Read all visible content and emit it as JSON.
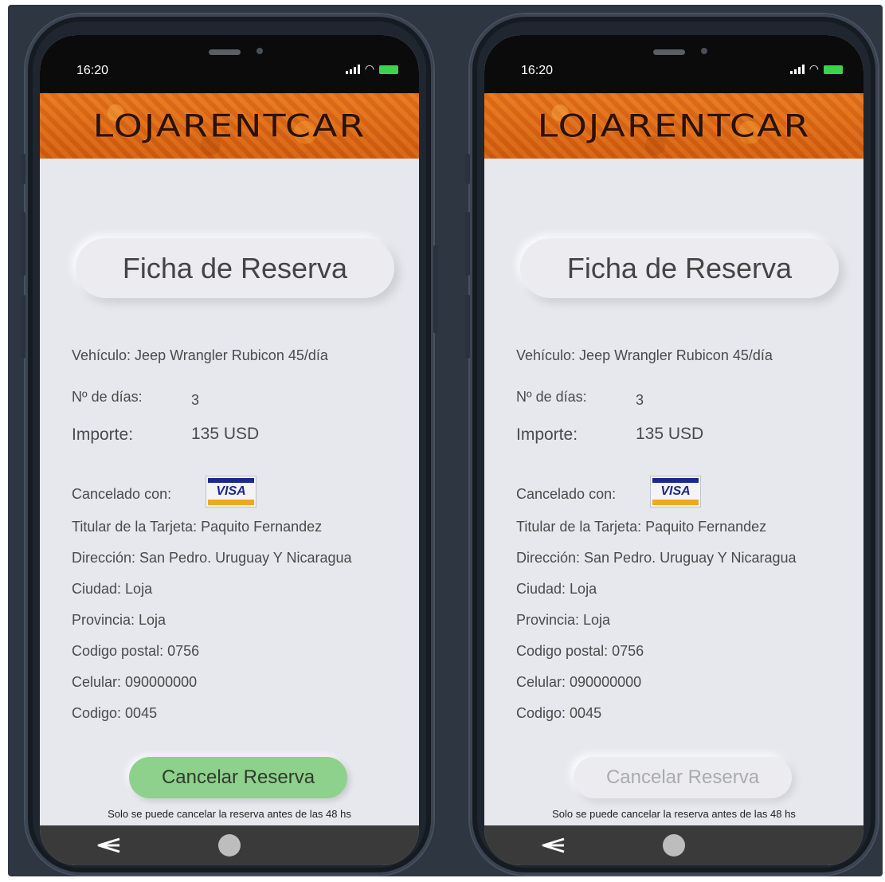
{
  "status": {
    "time": "16:20"
  },
  "brand": {
    "logo_text": "LOJARENTCAR"
  },
  "screen": {
    "title": "Ficha de Reserva",
    "vehicle": "Vehículo: Jeep Wrangler Rubicon 45/día",
    "days_label": "Nº de días:",
    "days_value": "3",
    "amount_label": "Importe:",
    "amount_value": "135  USD",
    "paid_with_label": "Cancelado con:",
    "card_brand": "VISA",
    "card_holder": "Titular de la Tarjeta: Paquito Fernandez",
    "address": "Dirección: San Pedro. Uruguay Y Nicaragua",
    "city": "Ciudad: Loja",
    "province": "Provincia: Loja",
    "postal_code": "Codigo postal:  0756",
    "phone": "Celular: 090000000",
    "code": "Codigo: 0045",
    "cancel_button": "Cancelar Reserva",
    "note": "Solo se puede cancelar la reserva antes de las 48 hs"
  },
  "states": {
    "left": "enabled",
    "right": "disabled"
  },
  "colors": {
    "brand_orange": "#e0691a",
    "cancel_active": "#8ed18c",
    "cancel_disabled": "#ececf0",
    "screen_bg": "#e6e8ee",
    "visa_blue": "#1a2a8a",
    "visa_gold": "#f1a81c"
  },
  "icons": {
    "signal": "signal-icon",
    "wifi": "wifi-icon",
    "battery": "battery-icon",
    "back": "back-icon",
    "home": "home-icon"
  }
}
